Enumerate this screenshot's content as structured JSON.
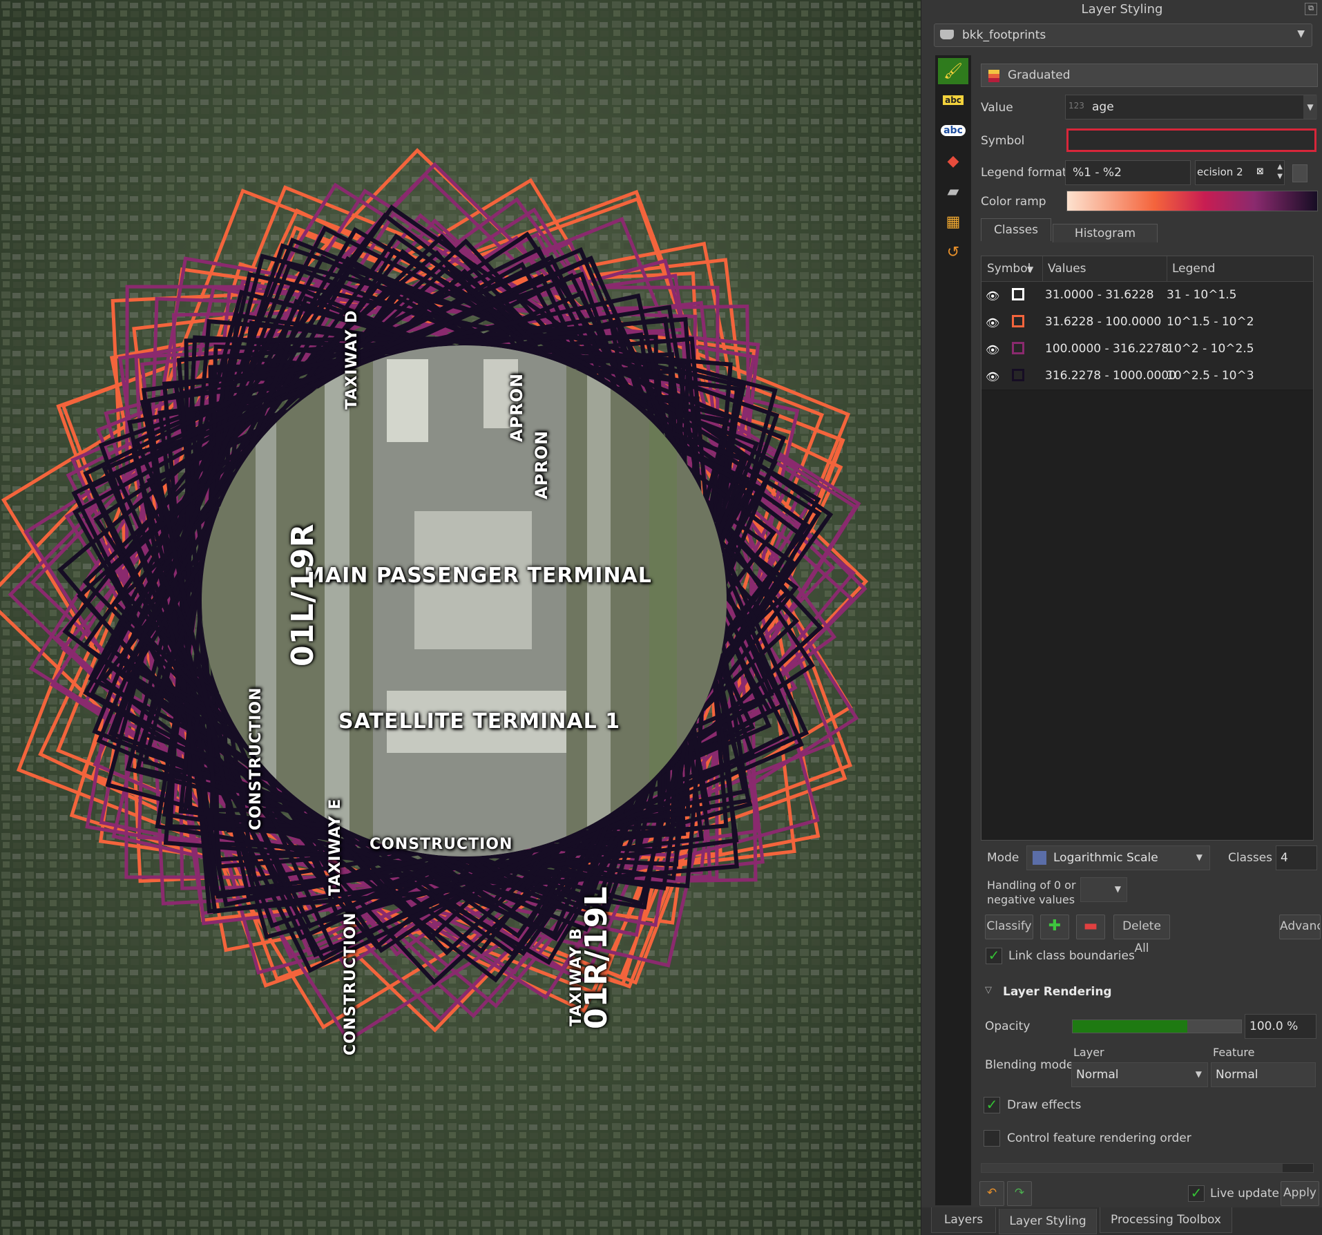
{
  "map": {
    "labels": {
      "main_terminal": "MAIN PASSENGER TERMINAL",
      "satellite_terminal": "SATELLITE TERMINAL 1",
      "taxiway_d": "TAXIWAY D",
      "taxiway_e": "TAXIWAY E",
      "taxiway_b": "TAXIWAY B",
      "apron_1": "APRON",
      "apron_2": "APRON",
      "runway_west": "01L/19R",
      "runway_east": "01R/19L",
      "construction_1": "CONSTRUCTION",
      "construction_2": "CONSTRUCTION",
      "construction_3": "CONSTRUCTION"
    },
    "colors": {
      "class1": "#ffffff",
      "class2": "#f4643c",
      "class3": "#8a2a6e",
      "class4": "#160d24"
    }
  },
  "panel": {
    "title": "Layer Styling",
    "layer_name": "bkk_footprints",
    "renderer": "Graduated",
    "value_label": "Value",
    "value_type_badge": "123",
    "value_field": "age",
    "symbol_label": "Symbol",
    "legend_format_label": "Legend format",
    "legend_format_value": "%1 - %2",
    "precision_value": "ecision 2",
    "color_ramp_label": "Color ramp",
    "tabs": [
      "Classes",
      "Histogram"
    ],
    "table": {
      "headers": [
        "Symbol",
        "Values",
        "Legend"
      ],
      "rows": [
        {
          "values": "31.0000 - 31.6228",
          "legend": "31 - 10^1.5",
          "color": "#ffffff"
        },
        {
          "values": "31.6228 - 100.0000",
          "legend": "10^1.5 - 10^2",
          "color": "#f4643c"
        },
        {
          "values": "100.0000 - 316.2278",
          "legend": "10^2 - 10^2.5",
          "color": "#8a2a6e"
        },
        {
          "values": "316.2278 - 1000.0000",
          "legend": "10^2.5 - 10^3",
          "color": "#160d24"
        }
      ]
    },
    "mode_label": "Mode",
    "mode_value": "Logarithmic Scale",
    "classes_label": "Classes",
    "classes_value": "4",
    "handling_label_1": "Handling of 0 or",
    "handling_label_2": "negative values",
    "classify_btn": "Classify",
    "delete_all_btn": "Delete All",
    "advanced_btn": "Advanc",
    "link_boundaries": "Link class boundaries",
    "layer_rendering": "Layer Rendering",
    "opacity_label": "Opacity",
    "opacity_value": "100.0 %",
    "opacity_fraction": 1.0,
    "blending_label": "Blending mode",
    "layer_col": "Layer",
    "feature_col": "Feature",
    "layer_blend": "Normal",
    "feature_blend": "Normal",
    "draw_effects": "Draw effects",
    "control_order": "Control feature rendering order",
    "live_update": "Live update",
    "apply_btn": "Apply",
    "bottom_tabs": [
      "Layers",
      "Layer Styling",
      "Processing Toolbox"
    ]
  }
}
